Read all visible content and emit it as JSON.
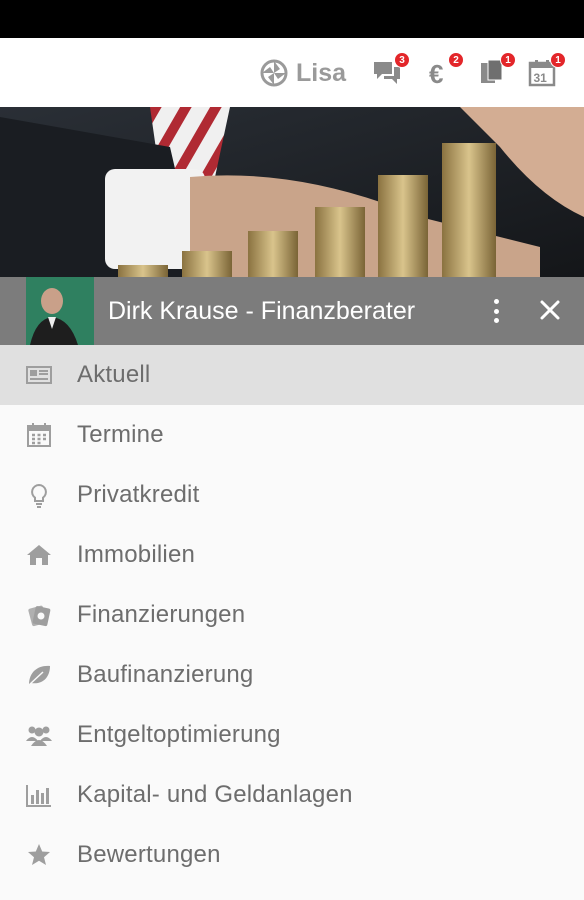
{
  "topbar": {
    "brand": "Lisa",
    "chat_badge": "3",
    "euro_badge": "2",
    "docs_badge": "1",
    "calendar_badge": "1",
    "calendar_day": "31"
  },
  "profile": {
    "name": "Dirk Krause - Finanzberater"
  },
  "menu": [
    {
      "label": "Aktuell",
      "icon": "newspaper-icon",
      "active": true
    },
    {
      "label": "Termine",
      "icon": "calendar-icon"
    },
    {
      "label": "Privatkredit",
      "icon": "lightbulb-icon"
    },
    {
      "label": "Immobilien",
      "icon": "home-icon"
    },
    {
      "label": "Finanzierungen",
      "icon": "money-icon"
    },
    {
      "label": "Baufinanzierung",
      "icon": "leaf-icon"
    },
    {
      "label": "Entgeltoptimierung",
      "icon": "users-icon"
    },
    {
      "label": "Kapital- und Geldanlagen",
      "icon": "bar-chart-icon"
    },
    {
      "label": "Bewertungen",
      "icon": "star-icon"
    }
  ],
  "colors": {
    "accent_red": "#e3262a",
    "profile_bar": "#7c7c7c",
    "active_row": "#e0e0e0",
    "text_gray": "#6d6d6d"
  }
}
